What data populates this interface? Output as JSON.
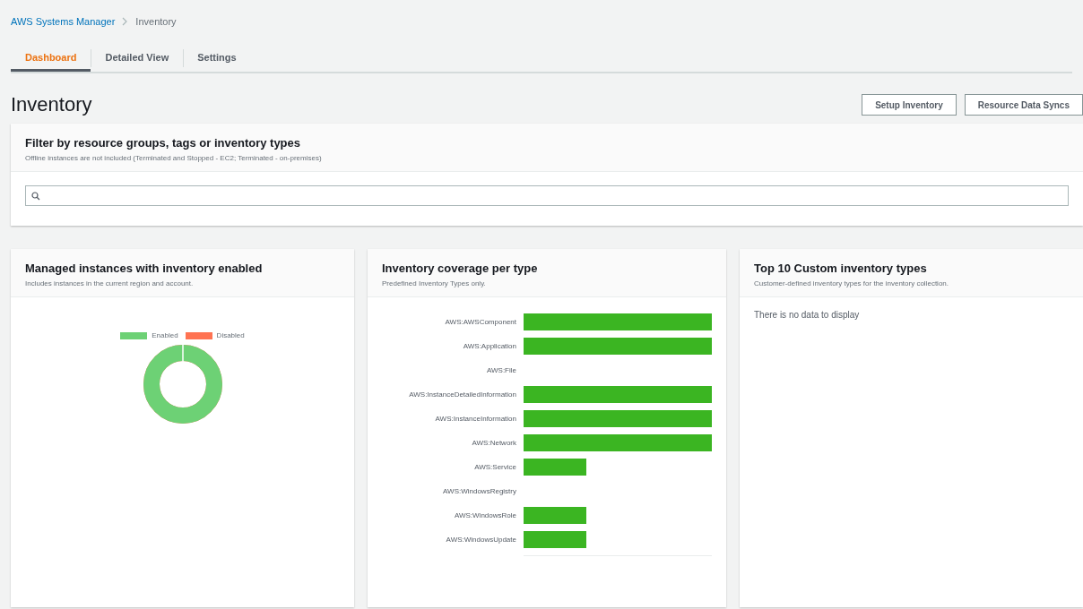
{
  "breadcrumb": [
    {
      "label": "AWS Systems Manager",
      "kind": "link"
    },
    {
      "label": "Inventory",
      "kind": "current"
    }
  ],
  "tabs": [
    {
      "label": "Dashboard",
      "selected": true
    },
    {
      "label": "Detailed View",
      "selected": false
    },
    {
      "label": "Settings",
      "selected": false
    }
  ],
  "page_title": "Inventory",
  "buttons": [
    "Setup Inventory",
    "Resource Data Syncs"
  ],
  "filter": {
    "title": "Filter by resource groups, tags or inventory types",
    "subtitle": "Offline instances are not included (Terminated and Stopped - EC2; Terminated - on-premises)"
  },
  "cards": [
    {
      "kind": "donut",
      "title": "Managed instances with inventory enabled",
      "subtitle": "Includes instances in the current region and account.",
      "legend": [
        {
          "label": "Enabled",
          "color": "#6dd175"
        },
        {
          "label": "Disabled",
          "color": "#ff7352"
        }
      ],
      "donut": {
        "level": 1
      }
    },
    {
      "kind": "bars",
      "title": "Inventory coverage per type",
      "subtitle": "Predefined Inventory Types only.",
      "bars": [
        {
          "label": "AWS:AWSComponent",
          "kind": "full"
        },
        {
          "label": "AWS:Application",
          "kind": "full"
        },
        {
          "label": "AWS:File",
          "kind": "none"
        },
        {
          "label": "AWS:InstanceDetailedInformation",
          "kind": "full"
        },
        {
          "label": "AWS:InstanceInformation",
          "kind": "full"
        },
        {
          "label": "AWS:Network",
          "kind": "full"
        },
        {
          "label": "AWS:Service",
          "kind": "partial"
        },
        {
          "label": "AWS:WindowsRegistry",
          "kind": "none"
        },
        {
          "label": "AWS:WindowsRole",
          "kind": "partial"
        },
        {
          "label": "AWS:WindowsUpdate",
          "kind": "partial"
        }
      ]
    },
    {
      "kind": "empty",
      "title": "Top 10 Custom inventory types",
      "subtitle": "Customer-defined inventory types for the inventory collection.",
      "message": "There is no data to display"
    }
  ]
}
